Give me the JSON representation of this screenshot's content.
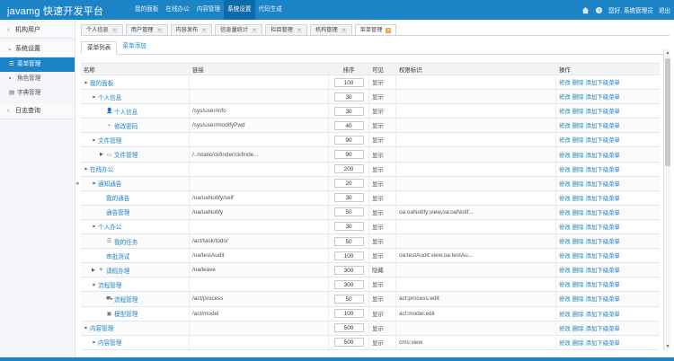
{
  "app": {
    "title": "javamg 快速开发平台"
  },
  "topnav": [
    "我的面板",
    "在线办公",
    "内容管理",
    "系统设置",
    "代码生成"
  ],
  "topnav_active": 3,
  "user": {
    "greeting": "您好, 系统管理员",
    "logout": "退出"
  },
  "sidebar": {
    "groups": [
      {
        "label": "机构用户",
        "expanded": false,
        "items": []
      },
      {
        "label": "系统设置",
        "expanded": true,
        "items": [
          {
            "label": "菜单管理",
            "icon": "list-icon",
            "active": true
          },
          {
            "label": "角色管理",
            "icon": "lock-icon",
            "active": false
          },
          {
            "label": "字典管理",
            "icon": "book-icon",
            "active": false
          }
        ]
      },
      {
        "label": "日志查询",
        "expanded": false,
        "items": []
      }
    ]
  },
  "tabs": [
    {
      "label": "个人信息",
      "active": false
    },
    {
      "label": "用户管理",
      "active": false
    },
    {
      "label": "内容发布",
      "active": false
    },
    {
      "label": "信息量统计",
      "active": false
    },
    {
      "label": "栏目管理",
      "active": false
    },
    {
      "label": "机构管理",
      "active": false
    },
    {
      "label": "菜单管理",
      "active": true
    }
  ],
  "subtabs": [
    {
      "label": "菜单列表",
      "active": true
    },
    {
      "label": "菜单添加",
      "active": false
    }
  ],
  "table": {
    "headers": [
      "名称",
      "链接",
      "排序",
      "可见",
      "权限标识",
      "操作"
    ],
    "ops": [
      "修改",
      "删除",
      "添加下级菜单"
    ],
    "rows": [
      {
        "level": 0,
        "expander": "down",
        "icon": "",
        "name": "我的面板",
        "href": "",
        "sort": "100",
        "visible": "显示",
        "permission": ""
      },
      {
        "level": 1,
        "expander": "down",
        "icon": "",
        "name": "个人信息",
        "href": "",
        "sort": "30",
        "visible": "显示",
        "permission": ""
      },
      {
        "level": 2,
        "expander": "",
        "icon": "user-icon",
        "name": "个人信息",
        "href": "/sys/user/info",
        "sort": "30",
        "visible": "显示",
        "permission": ""
      },
      {
        "level": 2,
        "expander": "",
        "icon": "lock-icon",
        "name": "修改密码",
        "href": "/sys/user/modifyPwd",
        "sort": "40",
        "visible": "显示",
        "permission": ""
      },
      {
        "level": 1,
        "expander": "down",
        "icon": "",
        "name": "文件管理",
        "href": "",
        "sort": "90",
        "visible": "显示",
        "permission": ""
      },
      {
        "level": 2,
        "expander": "right",
        "icon": "folder-icon",
        "name": "文件管理",
        "href": "/../static/ckfinder/ckfinde...",
        "sort": "90",
        "visible": "显示",
        "permission": ""
      },
      {
        "level": 0,
        "expander": "down",
        "icon": "",
        "name": "在线办公",
        "href": "",
        "sort": "200",
        "visible": "显示",
        "permission": ""
      },
      {
        "level": 1,
        "expander": "down",
        "icon": "",
        "name": "通知通告",
        "href": "",
        "sort": "20",
        "visible": "显示",
        "permission": ""
      },
      {
        "level": 2,
        "expander": "",
        "icon": "",
        "name": "我的通告",
        "href": "/oa/oaNotify/self",
        "sort": "30",
        "visible": "显示",
        "permission": ""
      },
      {
        "level": 2,
        "expander": "",
        "icon": "",
        "name": "通告管理",
        "href": "/oa/oaNotify",
        "sort": "50",
        "visible": "显示",
        "permission": "oa:oaNotify:view,oa:oaNotif..."
      },
      {
        "level": 1,
        "expander": "down",
        "icon": "",
        "name": "个人办公",
        "href": "",
        "sort": "30",
        "visible": "显示",
        "permission": ""
      },
      {
        "level": 2,
        "expander": "",
        "icon": "list-icon",
        "name": "我的任务",
        "href": "/act/task/todo/",
        "sort": "50",
        "visible": "显示",
        "permission": ""
      },
      {
        "level": 2,
        "expander": "",
        "icon": "",
        "name": "审批测试",
        "href": "/oa/testAudit",
        "sort": "100",
        "visible": "显示",
        "permission": "oa:testAudit:view,oa:testAu..."
      },
      {
        "level": 1,
        "expander": "right",
        "icon": "leaf-icon",
        "name": "请假办理",
        "href": "/oa/leave",
        "sort": "300",
        "visible": "隐藏",
        "permission": ""
      },
      {
        "level": 1,
        "expander": "down",
        "icon": "",
        "name": "流程管理",
        "href": "",
        "sort": "300",
        "visible": "显示",
        "permission": ""
      },
      {
        "level": 2,
        "expander": "",
        "icon": "road-icon",
        "name": "流程管理",
        "href": "/act/process",
        "sort": "50",
        "visible": "显示",
        "permission": "act:process:edit"
      },
      {
        "level": 2,
        "expander": "",
        "icon": "cube-icon",
        "name": "模型管理",
        "href": "/act/model",
        "sort": "100",
        "visible": "显示",
        "permission": "act:model:edit"
      },
      {
        "level": 0,
        "expander": "down",
        "icon": "",
        "name": "内容管理",
        "href": "",
        "sort": "500",
        "visible": "显示",
        "permission": ""
      },
      {
        "level": 1,
        "expander": "down",
        "icon": "",
        "name": "内容管理",
        "href": "",
        "sort": "500",
        "visible": "显示",
        "permission": "cms:view"
      }
    ]
  }
}
